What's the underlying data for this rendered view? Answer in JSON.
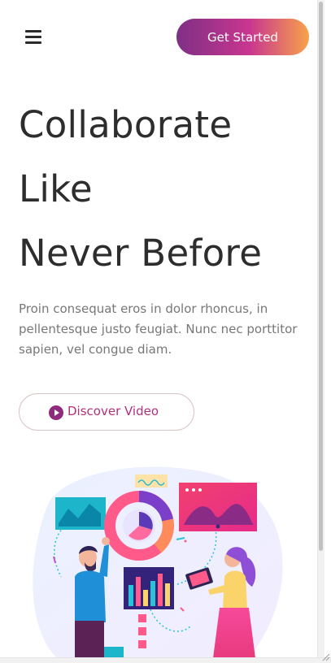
{
  "header": {
    "menu_icon": "hamburger-menu-icon",
    "cta_label": "Get Started"
  },
  "hero": {
    "title_lines": [
      "Collaborate",
      "Like",
      "Never Before"
    ],
    "text": "Proin consequat eros in dolor rhoncus, in pellentesque justo feugiat. Nunc nec porttitor sapien, vel congue diam.",
    "video_button_label": "Discover Video",
    "video_icon": "play-circle-icon"
  },
  "illustration": {
    "name": "team-collaboration-illustration"
  },
  "colors": {
    "gradient_start": "#7f2f86",
    "gradient_mid": "#c8368f",
    "gradient_end": "#f8a24a",
    "text_dark": "#2d2d2d",
    "text_muted": "#777777",
    "accent_magenta": "#b0307e"
  }
}
